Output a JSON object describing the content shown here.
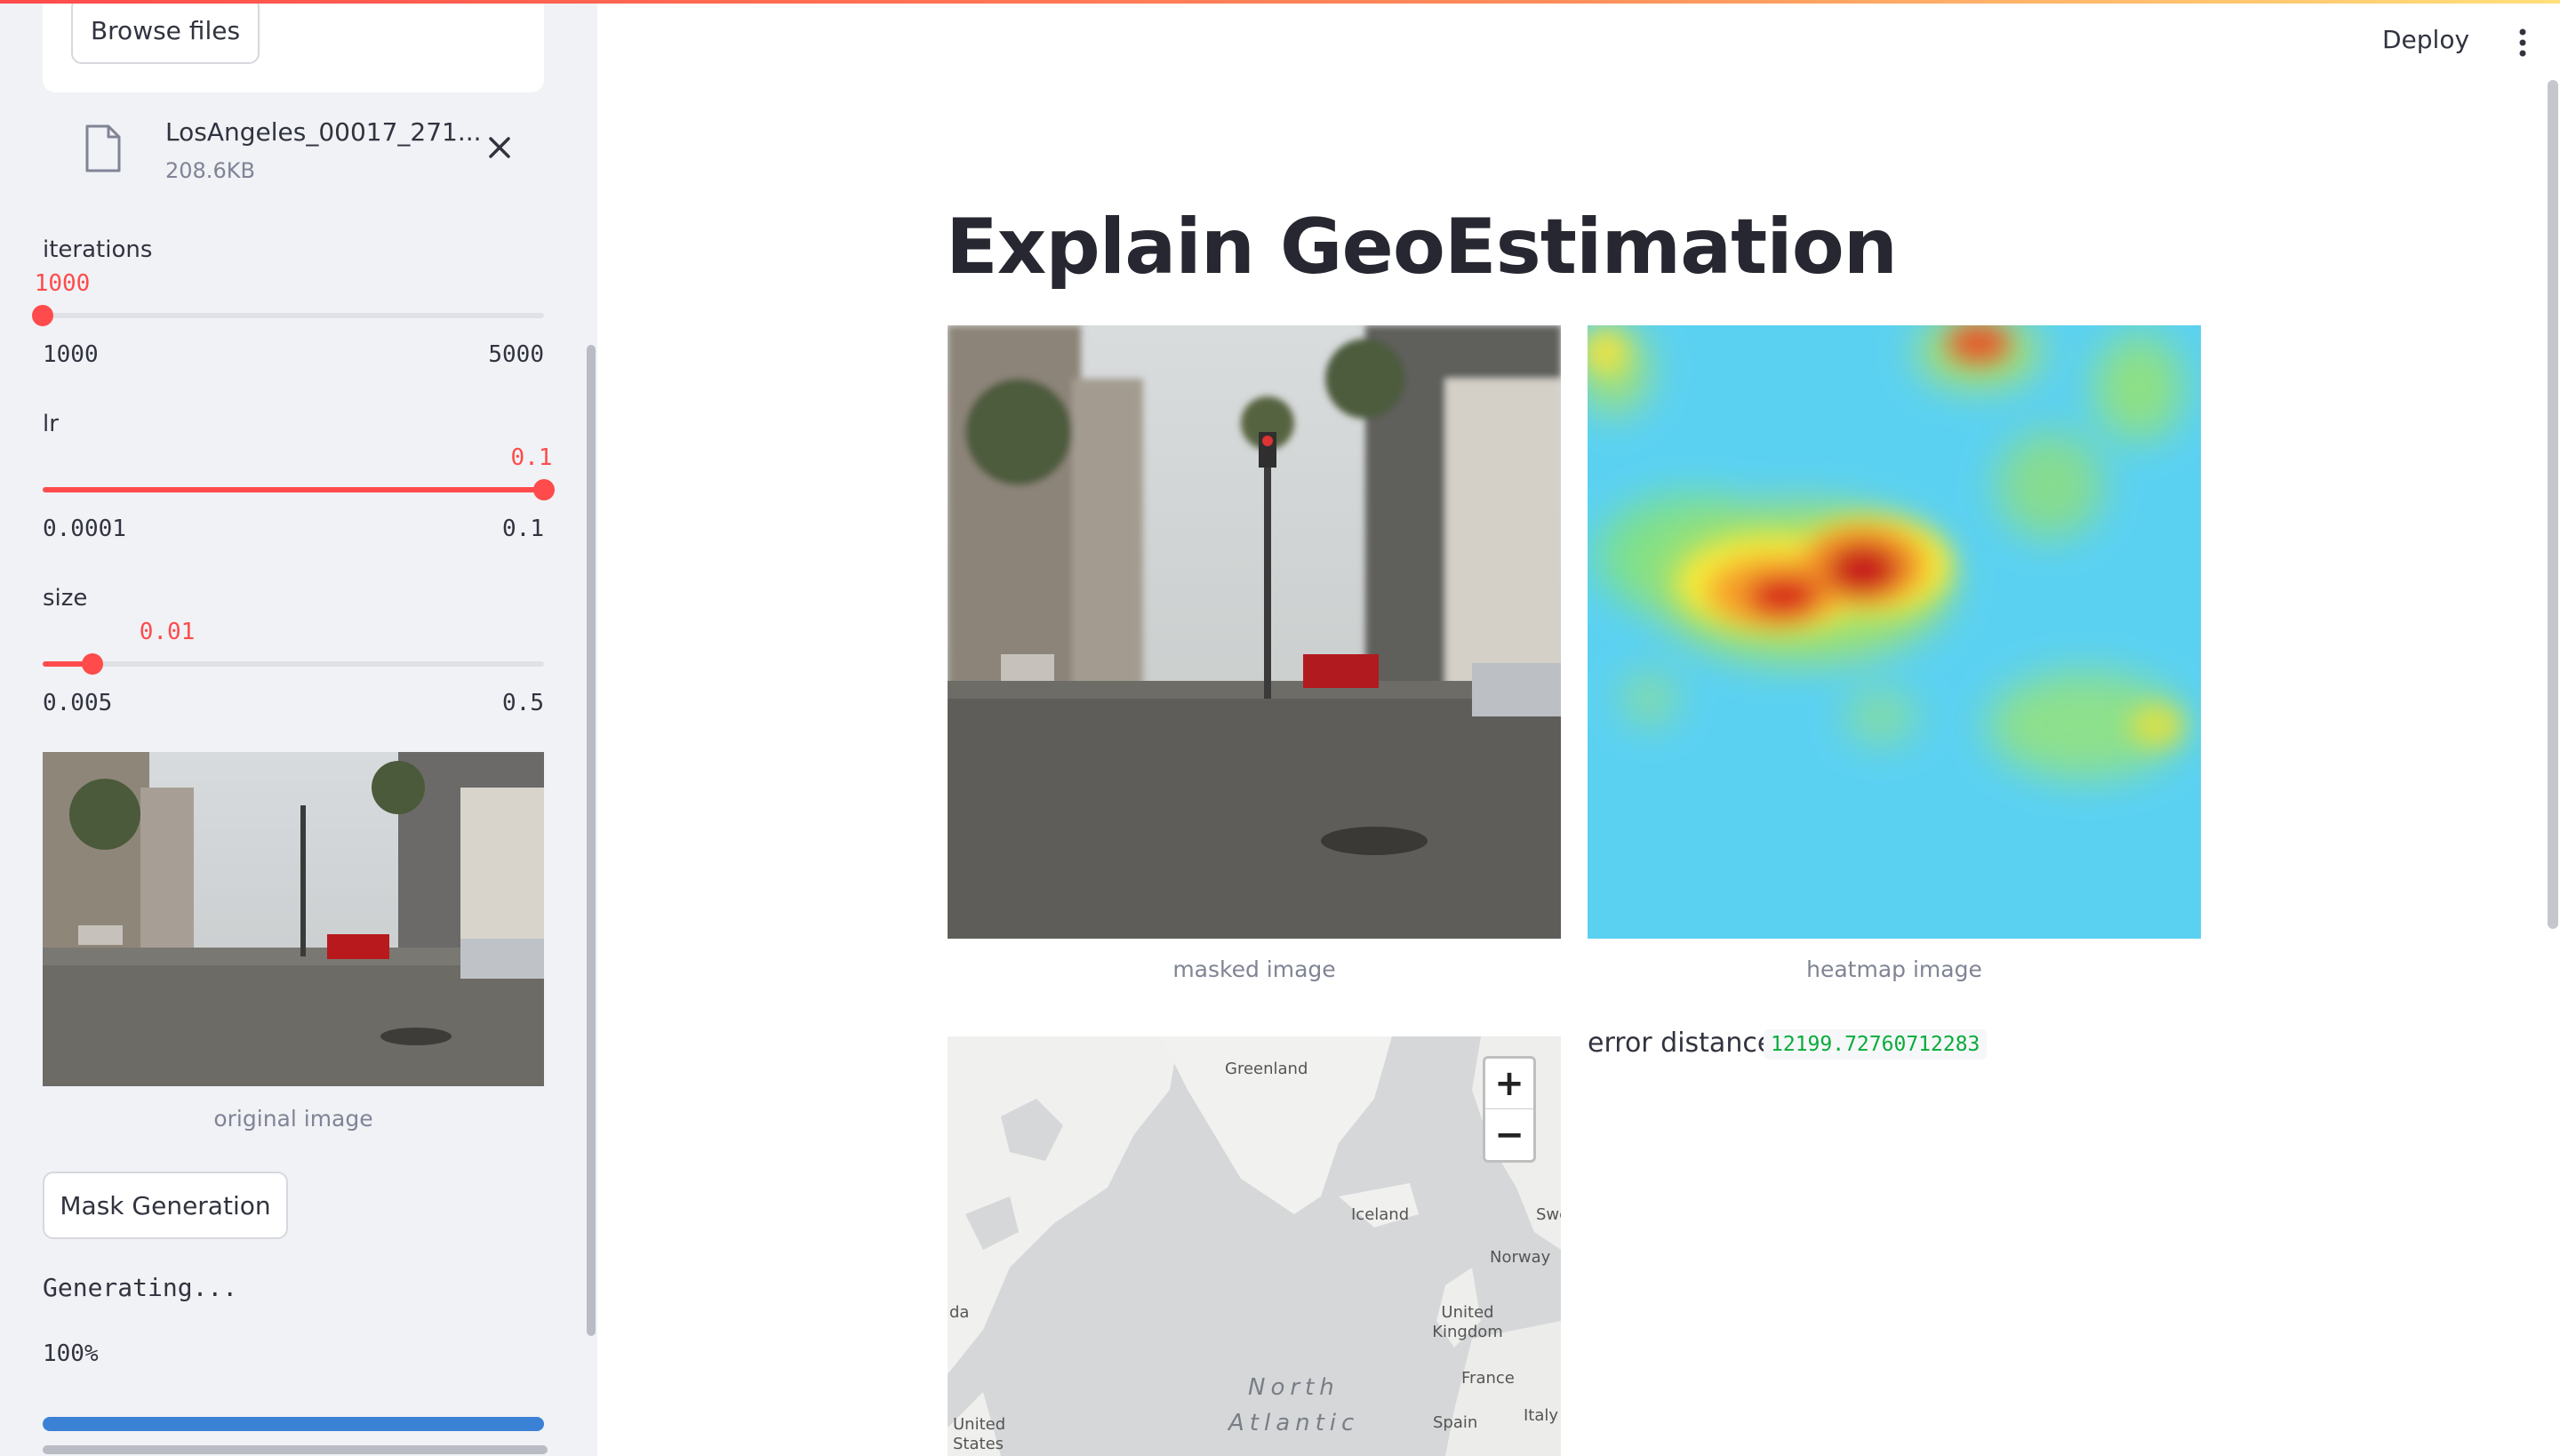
{
  "sidebar": {
    "uploader": {
      "browse_label": "Browse files",
      "file_name": "LosAngeles_00017_271...",
      "file_size": "208.6KB"
    },
    "sliders": [
      {
        "label": "iterations",
        "value": "1000",
        "min": "1000",
        "max": "5000",
        "fraction": 0.0
      },
      {
        "label": "lr",
        "value": "0.1",
        "min": "0.0001",
        "max": "0.1",
        "fraction": 1.0
      },
      {
        "label": "size",
        "value": "0.01",
        "min": "0.005",
        "max": "0.5",
        "fraction": 0.1
      }
    ],
    "original_caption": "original image",
    "mask_button": "Mask Generation",
    "status_text": "Generating...",
    "progress_text": "100%",
    "progress_fraction": 1.0
  },
  "header": {
    "deploy_label": "Deploy"
  },
  "main": {
    "title": "Explain GeoEstimation",
    "masked_caption": "masked image",
    "heatmap_caption": "heatmap image",
    "error_label": "error distance:",
    "error_value": "12199.72760712283",
    "map": {
      "labels": [
        "Greenland",
        "Iceland",
        "Swe",
        "Norway",
        "United Kingdom",
        "France",
        "Italy",
        "Spain",
        "da",
        "United States"
      ],
      "ocean_label_1": "North",
      "ocean_label_2": "Atlantic",
      "zoom_in": "+",
      "zoom_out": "−"
    }
  },
  "colors": {
    "accent": "#ff4b4b",
    "progress": "#3b82d6",
    "code_green": "#09ab3b",
    "sidebar_bg": "#f0f2f6"
  }
}
